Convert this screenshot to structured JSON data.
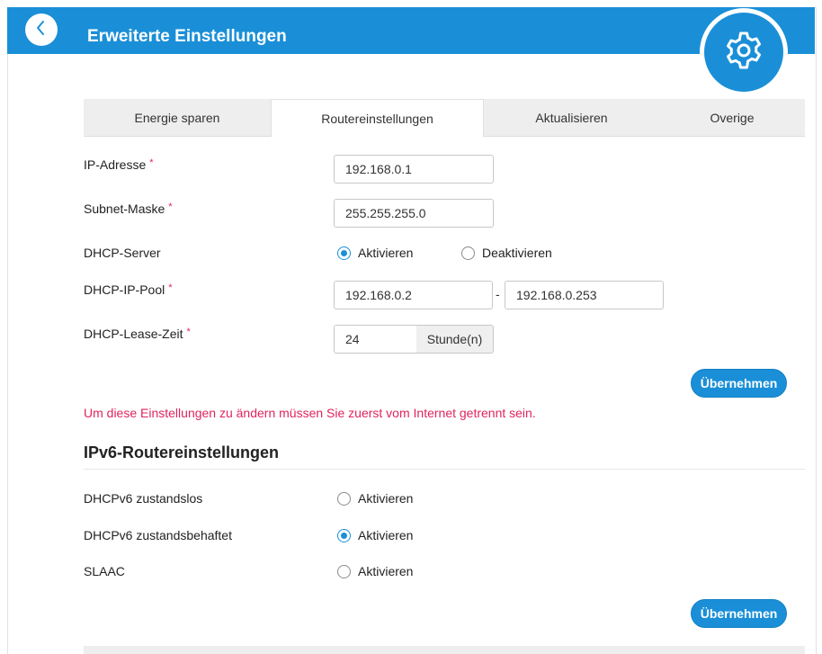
{
  "header": {
    "title": "Erweiterte Einstellungen",
    "back_icon": "chevron-left-icon",
    "settings_icon": "gear-icon",
    "accent_color": "#1a8fd8"
  },
  "tabs": [
    {
      "label": "Energie sparen",
      "active": false
    },
    {
      "label": "Routereinstellungen",
      "active": true
    },
    {
      "label": "Aktualisieren",
      "active": false
    },
    {
      "label": "Overige",
      "active": false
    }
  ],
  "router": {
    "ip": {
      "label": "IP-Adresse",
      "required": "*",
      "value": "192.168.0.1"
    },
    "subnet": {
      "label": "Subnet-Maske",
      "required": "*",
      "value": "255.255.255.0"
    },
    "dhcp_server": {
      "label": "DHCP-Server",
      "option_on": "Aktivieren",
      "option_off": "Deaktivieren",
      "selected": "Aktivieren"
    },
    "dhcp_pool": {
      "label": "DHCP-IP-Pool",
      "required": "*",
      "start": "192.168.0.2",
      "separator": "-",
      "end": "192.168.0.253"
    },
    "lease": {
      "label": "DHCP-Lease-Zeit",
      "required": "*",
      "value": "24",
      "unit": "Stunde(n)"
    },
    "apply_label": "Übernehmen"
  },
  "warning_text": "Um diese Einstellungen zu ändern müssen Sie zuerst vom Internet getrennt sein.",
  "ipv6": {
    "title": "IPv6-Routereinstellungen",
    "stateless": {
      "label": "DHCPv6 zustandslos",
      "option": "Aktivieren",
      "checked": false
    },
    "stateful": {
      "label": "DHCPv6 zustandsbehaftet",
      "option": "Aktivieren",
      "checked": true
    },
    "slaac": {
      "label": "SLAAC",
      "option": "Aktivieren",
      "checked": false
    },
    "apply_label": "Übernehmen"
  },
  "colors": {
    "warning": "#e0245e",
    "required": "#e0245e"
  }
}
